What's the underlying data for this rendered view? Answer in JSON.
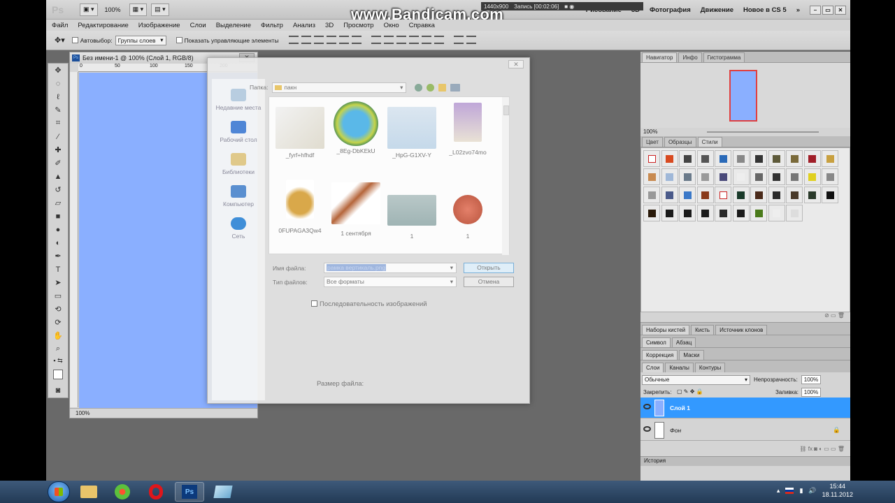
{
  "watermark": "www.Bandicam.com",
  "recorder": {
    "resolution": "1440x900",
    "recording": "Запись [00:02:06]"
  },
  "appbar": {
    "logo": "Ps",
    "zoom": "100%",
    "workspaces": [
      "Рисование",
      "3D",
      "Фотография",
      "Движение",
      "Новое в CS 5"
    ]
  },
  "menu": [
    "Файл",
    "Редактирование",
    "Изображение",
    "Слои",
    "Выделение",
    "Фильтр",
    "Анализ",
    "3D",
    "Просмотр",
    "Окно",
    "Справка"
  ],
  "options": {
    "autoselect": "Автовыбор:",
    "autoselect_value": "Группы слоев",
    "show_controls": "Показать управляющие элементы"
  },
  "document": {
    "title": "Без имени-1 @ 100% (Слой 1, RGB/8)",
    "zoom": "100%",
    "ruler_ticks": [
      "0",
      "50",
      "100",
      "150",
      "200"
    ]
  },
  "dialog": {
    "folder_label": "Папка:",
    "folder_value": "пакн",
    "places": [
      "Недавние места",
      "Рабочий стол",
      "Библиотеки",
      "Компьютер",
      "Сеть"
    ],
    "files": [
      "_fyrf+hfhdf",
      "_8Eg-DbKEkU",
      "_HpG-G1XV-Y",
      "_L02zvo74mo",
      "0FUPAGA3Qw4",
      "1 сентября",
      "1",
      "1"
    ],
    "filename_label": "Имя файла:",
    "filename_value": "рамка вертикаль.png",
    "filetype_label": "Тип файлов:",
    "filetype_value": "Все форматы",
    "open_button": "Открыть",
    "cancel_button": "Отмена",
    "sequence_label": "Последовательность изображений",
    "filesize_label": "Размер файла:"
  },
  "panels": {
    "navigator_tabs": [
      "Навигатор",
      "Инфо",
      "Гистограмма"
    ],
    "navigator_zoom": "100%",
    "styles_tabs": [
      "Цвет",
      "Образцы",
      "Стили"
    ],
    "brush_tabs": [
      "Наборы кистей",
      "Кисть",
      "Источник клонов"
    ],
    "symbol_tabs": [
      "Символ",
      "Абзац"
    ],
    "correction_tabs": [
      "Коррекция",
      "Маски"
    ],
    "layers_tabs": [
      "Слои",
      "Каналы",
      "Контуры"
    ],
    "blend_mode": "Обычные",
    "opacity_label": "Непрозрачность:",
    "opacity_value": "100%",
    "lock_label": "Закрепить:",
    "fill_label": "Заливка:",
    "fill_value": "100%",
    "layers": [
      "Слой 1",
      "Фон"
    ],
    "history_tab": "История"
  },
  "taskbar": {
    "time": "15:44",
    "date": "18.11.2012"
  },
  "colors": {
    "canvas": "#8aafff",
    "selected_layer": "#3399ff",
    "swatch_red_border": "#e04040"
  }
}
